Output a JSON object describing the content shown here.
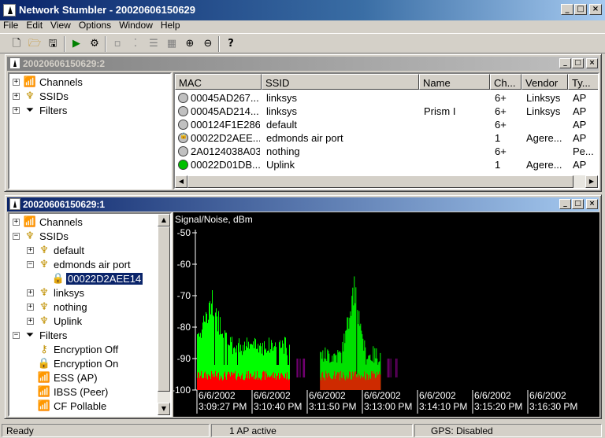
{
  "app": {
    "title": "Network Stumbler - 20020606150629"
  },
  "menu": [
    "File",
    "Edit",
    "View",
    "Options",
    "Window",
    "Help"
  ],
  "toolbar": {
    "buttons": [
      "new-icon",
      "open-icon",
      "save-icon",
      "play-icon",
      "auto-config-icon",
      "large-icons-icon",
      "small-icons-icon",
      "list-icon",
      "details-icon",
      "zoom-in-icon",
      "zoom-out-icon",
      "help-icon"
    ]
  },
  "window_top": {
    "title": "20020606150629:2",
    "tree": [
      "Channels",
      "SSIDs",
      "Filters"
    ],
    "columns": [
      "MAC",
      "SSID",
      "Name",
      "Ch...",
      "Vendor",
      "Ty..."
    ],
    "rows": [
      {
        "mac": "00045AD267...",
        "ssid": "linksys",
        "name": "",
        "ch": "6+",
        "vendor": "Linksys",
        "type": "AP",
        "status": "gray"
      },
      {
        "mac": "00045AD214...",
        "ssid": "linksys",
        "name": "Prism I",
        "ch": "6+",
        "vendor": "Linksys",
        "type": "AP",
        "status": "gray"
      },
      {
        "mac": "000124F1E286",
        "ssid": "default",
        "name": "",
        "ch": "6+",
        "vendor": "",
        "type": "AP",
        "status": "gray"
      },
      {
        "mac": "00022D2AEE...",
        "ssid": "edmonds air port",
        "name": "",
        "ch": "1",
        "vendor": "Agere...",
        "type": "AP",
        "status": "lock"
      },
      {
        "mac": "2A0124038A03",
        "ssid": "nothing",
        "name": "",
        "ch": "6+",
        "vendor": "",
        "type": "Pe...",
        "status": "gray"
      },
      {
        "mac": "00022D01DB...",
        "ssid": "Uplink",
        "name": "",
        "ch": "1",
        "vendor": "Agere...",
        "type": "AP",
        "status": "green"
      }
    ]
  },
  "window_bottom": {
    "title": "20020606150629:1",
    "tree": {
      "channels": "Channels",
      "ssids": "SSIDs",
      "ssid_default": "default",
      "ssid_edmonds": "edmonds air port",
      "ssid_edmonds_mac": "00022D2AEE14",
      "ssid_linksys": "linksys",
      "ssid_nothing": "nothing",
      "ssid_uplink": "Uplink",
      "filters": "Filters",
      "f_enc_off": "Encryption Off",
      "f_enc_on": "Encryption On",
      "f_ess": "ESS (AP)",
      "f_ibss": "IBSS (Peer)",
      "f_cf": "CF Pollable"
    }
  },
  "chart_data": {
    "type": "bar",
    "title": "Signal/Noise, dBm",
    "ylim": [
      -100,
      -50
    ],
    "yticks": [
      "-50",
      "-60",
      "-70",
      "-80",
      "-90",
      "-100"
    ],
    "xticks": [
      {
        "date": "6/6/2002",
        "time": "3:09:27 PM"
      },
      {
        "date": "6/6/2002",
        "time": "3:10:40 PM"
      },
      {
        "date": "6/6/2002",
        "time": "3:11:50 PM"
      },
      {
        "date": "6/6/2002",
        "time": "3:13:00 PM"
      },
      {
        "date": "6/6/2002",
        "time": "3:14:10 PM"
      },
      {
        "date": "6/6/2002",
        "time": "3:15:20 PM"
      },
      {
        "date": "6/6/2002",
        "time": "3:16:30 PM"
      }
    ],
    "colors": {
      "signal": "#00ff00",
      "noise": "#ff0000",
      "background": "#000000",
      "gap": "#800080"
    },
    "series": [
      {
        "name": "signal",
        "segments": [
          {
            "t_start": "3:09:27 PM",
            "t_end": "3:11:30 PM",
            "typical": -86,
            "peak": -69
          },
          {
            "t_start": "3:12:10 PM",
            "t_end": "3:13:30 PM",
            "typical": -89,
            "peak": -62
          }
        ]
      },
      {
        "name": "noise",
        "values_typical": -96
      }
    ]
  },
  "status": {
    "left": "Ready",
    "middle": "1 AP active",
    "right": "GPS: Disabled"
  }
}
